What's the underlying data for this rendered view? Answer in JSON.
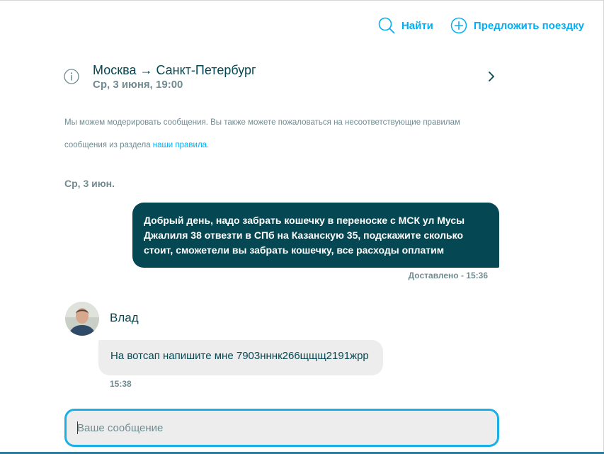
{
  "topnav": {
    "search_label": "Найти",
    "offer_label": "Предложить поездку"
  },
  "trip": {
    "route": "Москва → Санкт-Петербург",
    "date": "Ср, 3 июня, 19:00"
  },
  "notice": {
    "text_before": "Мы можем модерировать сообщения. Вы также можете пожаловаться на несоответствующие правилам сообщения из раздела ",
    "link_text": "наши правила",
    "text_after": "."
  },
  "conversation": {
    "day_label": "Ср, 3 июн.",
    "outgoing": {
      "text": "Добрый день, надо забрать кошечку в переноске с МСК ул Мусы Джалиля 38 отвезти в СПб на Казанскую 35, подскажите сколько стоит, сможетели вы забрать кошечку, все расходы оплатим",
      "status": "Доставлено - 15:36"
    },
    "incoming": {
      "sender": "Влад",
      "text": "На вотсап напишите мне 7903нннк266щщщ2191жрр",
      "time": "15:38"
    }
  },
  "composer": {
    "placeholder": "Ваше сообщение",
    "value": ""
  },
  "colors": {
    "accent": "#00aff5",
    "dark": "#054752",
    "muted": "#708c91",
    "bubble_in": "#ededed",
    "composer_border": "#19b0e6"
  }
}
